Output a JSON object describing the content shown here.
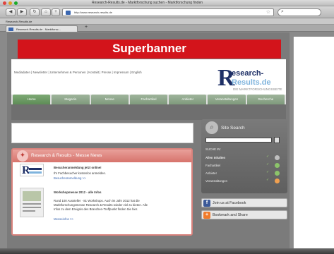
{
  "window": {
    "title": "Research-Results.de - Marktforschung suchen - Marktforschung finden"
  },
  "toolbar": {
    "back": "◀",
    "forward": "▶",
    "reload": "↻",
    "home": "⌂",
    "add": "+",
    "url": "http://www.research-results.de"
  },
  "bookmarks_bar": {
    "text": "Research-Results.de"
  },
  "tab": {
    "title": "Research-Results.de - Marktforsc..."
  },
  "banner": {
    "text": "Superbanner",
    "color": "#d3141b"
  },
  "top_nav": {
    "text": "Mediadaten | Newsletter | Unternehmen & Personen | Kontakt | Presse | Impressum | English"
  },
  "logo": {
    "letter": "R",
    "line1": "esearch-",
    "line2": "Results.de",
    "tagline": "DIE MARKTFORSCHUNGSSEITE"
  },
  "menu": {
    "items": [
      "Home",
      "Magazin",
      "Messe",
      "Fachartikel",
      "Anbieter",
      "Veranstaltungen",
      "Recherche"
    ]
  },
  "news": {
    "title": "Research & Results - Messe News",
    "item1": {
      "headline": "Besucheranmeldung jetzt online!",
      "text": "Ihr Fachbesucher kostenlos anmelden.",
      "link": "Besucheranmeldung >>"
    },
    "item2": {
      "headline": "Workshopmesse 2012 - alle Infos",
      "lines": [
        "Rund 100 Aussteller · 81 Workshops. Auch im Jahr 2012 hat die",
        "Marktforschungsmesse Research & Results wieder viel zu bieten. Alle",
        "Infos zu dem Ereignis des Branchen-Treffpunkt finden Sie hier."
      ],
      "link": "Messeinfos >>"
    }
  },
  "site_search": {
    "title": "Site Search",
    "label": "SUCHE IN:",
    "rows": [
      {
        "label": "Allen Inhalten",
        "circle": "#bfbfbf"
      },
      {
        "label": "Fachartikel",
        "circle": "#8cc46a"
      },
      {
        "label": "Anbieter",
        "circle": "#8cc46a"
      },
      {
        "label": "Veranstaltungen",
        "circle": "#f0a050"
      }
    ]
  },
  "social": {
    "facebook": {
      "label": "Join us at Facebook",
      "icon": "f",
      "color": "#3b5998"
    },
    "bookmark": {
      "label": "Bookmark and Share",
      "icon": "+",
      "color": "#f07b2b"
    }
  }
}
